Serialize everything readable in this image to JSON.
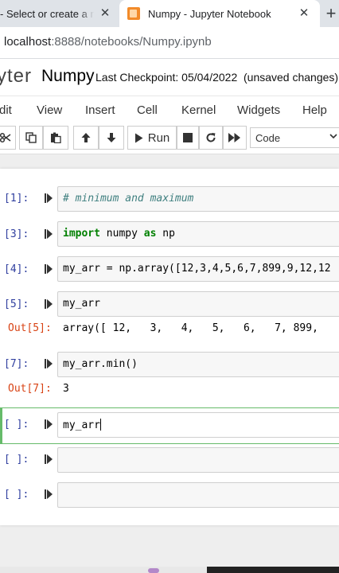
{
  "browser": {
    "tabs": [
      {
        "title": "- Select or create a n",
        "close": "✕",
        "active": false
      },
      {
        "title": "Numpy - Jupyter Notebook",
        "close": "✕",
        "active": true
      }
    ],
    "new_tab": "+",
    "url_host": "localhost",
    "url_path": ":8888/notebooks/Numpy.ipynb"
  },
  "header": {
    "logo": "yter",
    "notebook_name": "Numpy",
    "checkpoint": "Last Checkpoint: 05/04/2022",
    "status": "(unsaved changes)"
  },
  "menu": [
    "dit",
    "View",
    "Insert",
    "Cell",
    "Kernel",
    "Widgets",
    "Help"
  ],
  "toolbar": {
    "run_label": "Run",
    "cell_type": "Code",
    "icons": [
      "scissors-icon",
      "copy-icon",
      "paste-icon",
      "move-up-icon",
      "move-down-icon",
      "run-icon",
      "stop-icon",
      "restart-icon",
      "fast-forward-icon"
    ]
  },
  "cells": [
    {
      "prompt": "[1]:",
      "code": "# minimum and maximum"
    },
    {
      "prompt": "[3]:",
      "code_kw": "import",
      "code_rest": " numpy ",
      "code_kw2": "as",
      "code_rest2": " np"
    },
    {
      "prompt": "[4]:",
      "code": "my_arr = np.array([12,3,4,5,6,7,899,9,12,12"
    },
    {
      "prompt": "[5]:",
      "code": "my_arr",
      "out_prompt": "Out[5]:",
      "output": "array([ 12,   3,   4,   5,   6,   7, 899,"
    },
    {
      "prompt": "[7]:",
      "code": "my_arr.min()",
      "out_prompt": "Out[7]:",
      "output": "3"
    },
    {
      "prompt": "[ ]:",
      "code": "my_arr",
      "selected": true
    },
    {
      "prompt": "[ ]:",
      "code": ""
    },
    {
      "prompt": "[ ]:",
      "code": ""
    }
  ]
}
